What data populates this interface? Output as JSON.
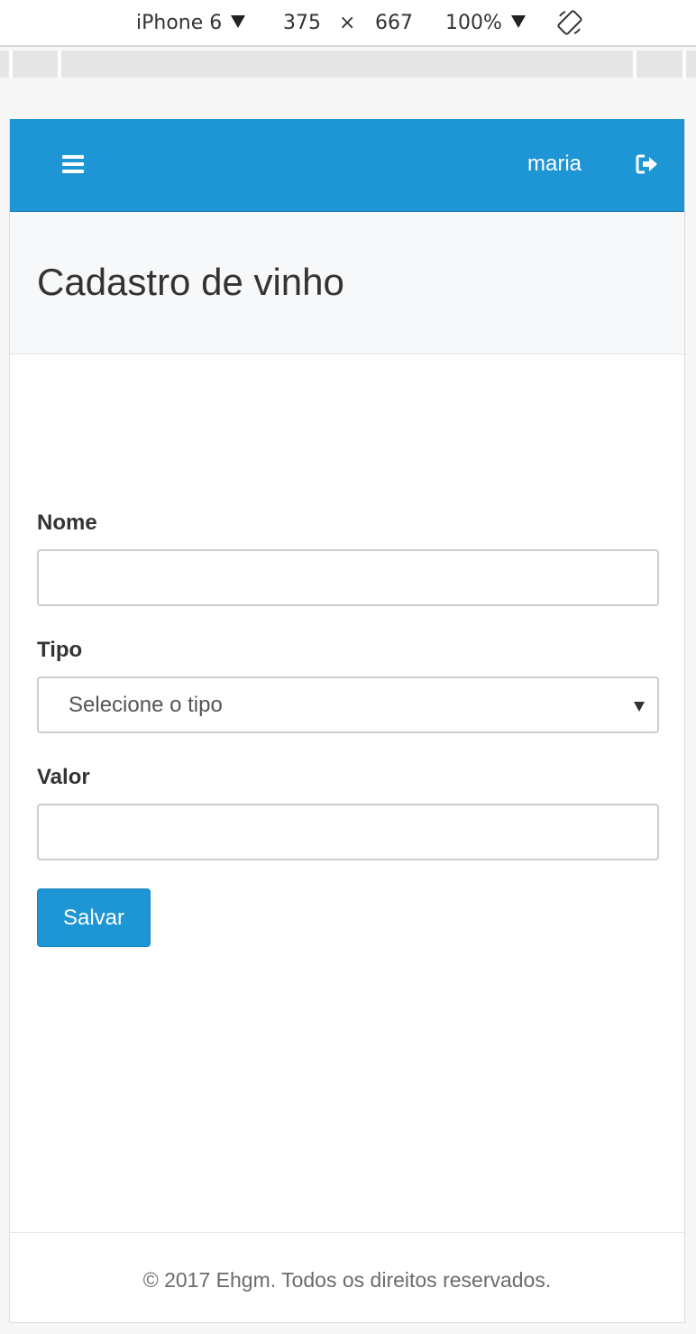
{
  "devtools": {
    "device": "iPhone 6",
    "width": "375",
    "times": "×",
    "height": "667",
    "zoom": "100%"
  },
  "navbar": {
    "menu_icon": "hamburger-menu-icon",
    "user": "maria",
    "logout_icon": "sign-out-icon",
    "color": "#1e95d4"
  },
  "page": {
    "title": "Cadastro de vinho"
  },
  "form": {
    "nome_label": "Nome",
    "nome_value": "",
    "tipo_label": "Tipo",
    "tipo_selected": "Selecione o tipo",
    "valor_label": "Valor",
    "valor_value": "",
    "save_label": "Salvar"
  },
  "footer": {
    "text": "© 2017 Ehgm. Todos os direitos reservados."
  }
}
